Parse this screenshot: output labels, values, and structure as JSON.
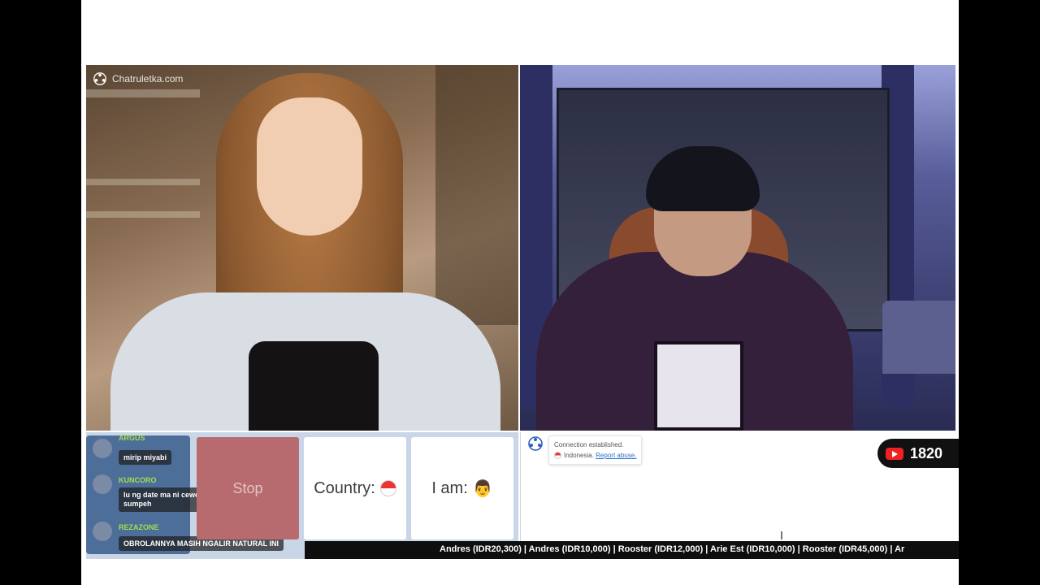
{
  "app": {
    "logo_text": "Chatruletka.com"
  },
  "controls": {
    "stop_label": "Stop",
    "country_label": "Country:",
    "iam_label": "I am:"
  },
  "chat_overlay": {
    "messages": [
      {
        "name": "ARGUS",
        "text": "mirip miyabi"
      },
      {
        "name": "KUNCORO",
        "text": "lu ng date ma ni cewek bakal cocok banget ri sumpeh"
      },
      {
        "name": "REZAZONE",
        "text": "OBROLANNYA MASIH NGALIR NATURAL INI"
      }
    ]
  },
  "system_message": {
    "line1": "Connection established.",
    "country": "Indonesia.",
    "link": "Report abuse."
  },
  "stream": {
    "viewer_count": "1820"
  },
  "ticker": {
    "text": "Andres (IDR20,300) | Andres (IDR10,000) | Rooster (IDR12,000) | Arie Est (IDR10,000) | Rooster (IDR45,000) | Ar"
  },
  "colors": {
    "accent": "#e22222",
    "stop": "#b86b6e",
    "panel": "#c9d6e8"
  }
}
